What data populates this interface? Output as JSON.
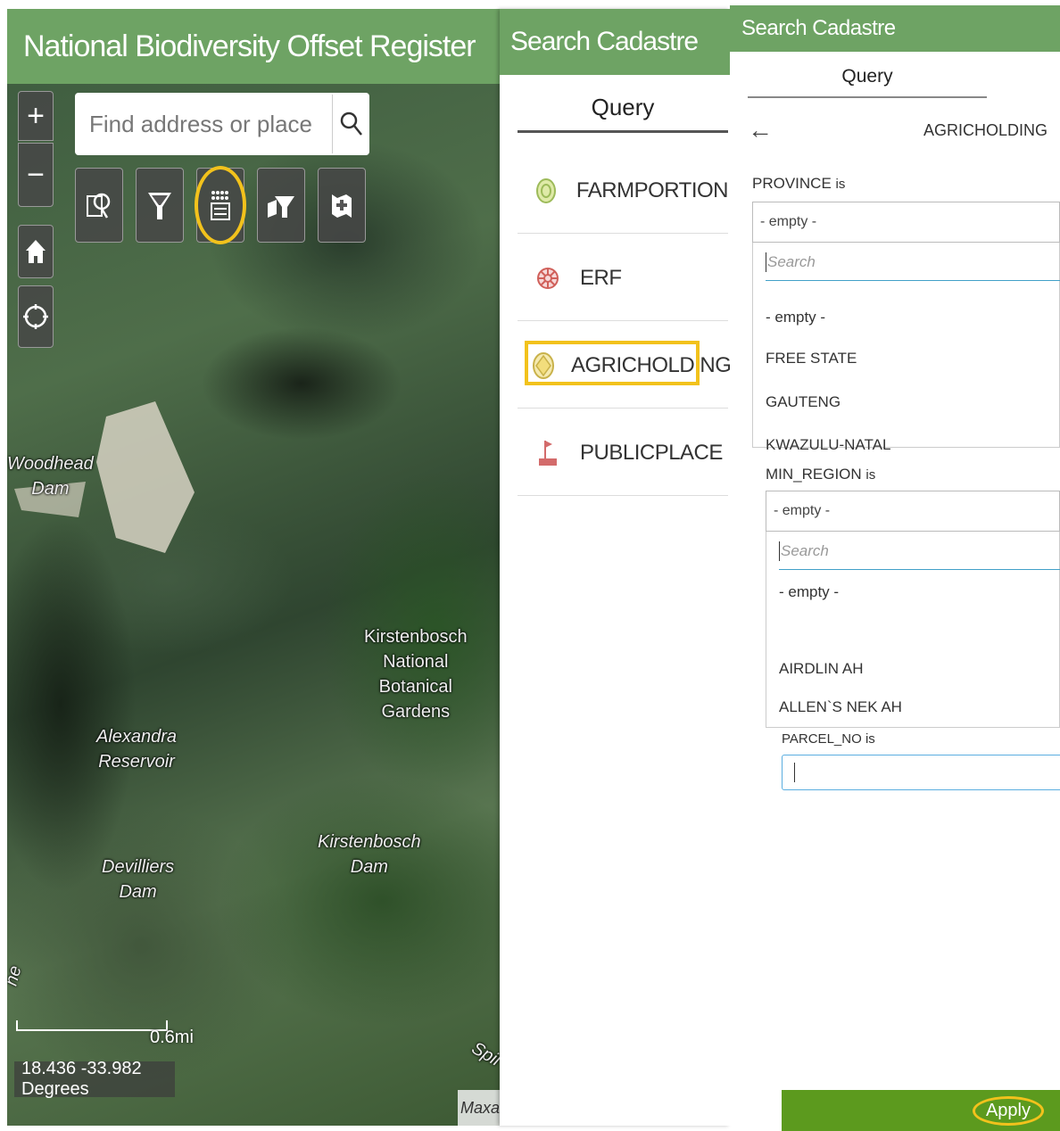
{
  "map": {
    "title": "National Biodiversity Offset Register",
    "search_placeholder": "Find address or place",
    "zoom_in": "+",
    "zoom_out": "−",
    "labels": {
      "woodhead": "Woodhead\nDam",
      "kirstenbosch_gardens": "Kirstenbosch\nNational\nBotanical\nGardens",
      "alexandra": "Alexandra\nReservoir",
      "kirstenbosch_dam": "Kirstenbosch\nDam",
      "devilliers": "Devilliers\nDam",
      "spil": "Spil",
      "edge": "ne"
    },
    "scale_label": "0.6mi",
    "coordinates": "18.436 -33.982 Degrees",
    "attribution": "Maxar"
  },
  "middle_panel": {
    "title": "Search Cadastre",
    "tab": "Query",
    "layers": [
      {
        "label": "FARMPORTION",
        "icon": "farmportion-icon"
      },
      {
        "label": "ERF",
        "icon": "erf-icon"
      },
      {
        "label": "AGRICHOLDING",
        "icon": "agricholding-icon"
      },
      {
        "label": "PUBLICPLACE",
        "icon": "publicplace-icon"
      }
    ]
  },
  "right_panel": {
    "title": "Search Cadastre",
    "tab": "Query",
    "layer_title": "AGRICHOLDING",
    "province": {
      "label": "PROVINCE",
      "suffix": "is",
      "value": "- empty -",
      "search_placeholder": "Search",
      "options": [
        "- empty -",
        "FREE STATE",
        "GAUTENG",
        "KWAZULU-NATAL"
      ]
    },
    "min_region": {
      "label": "MIN_REGION",
      "suffix": "is",
      "value": "- empty -",
      "search_placeholder": "Search",
      "options": [
        "- empty -",
        "AIRDLIN AH",
        "ALLEN`S NEK AH"
      ]
    },
    "parcel_no": {
      "label": "PARCEL_NO",
      "suffix": "is"
    },
    "apply_label": "Apply"
  },
  "colors": {
    "header_green": "#6ea364",
    "apply_green": "#5c9a1e",
    "highlight_yellow": "#f2c21c"
  }
}
